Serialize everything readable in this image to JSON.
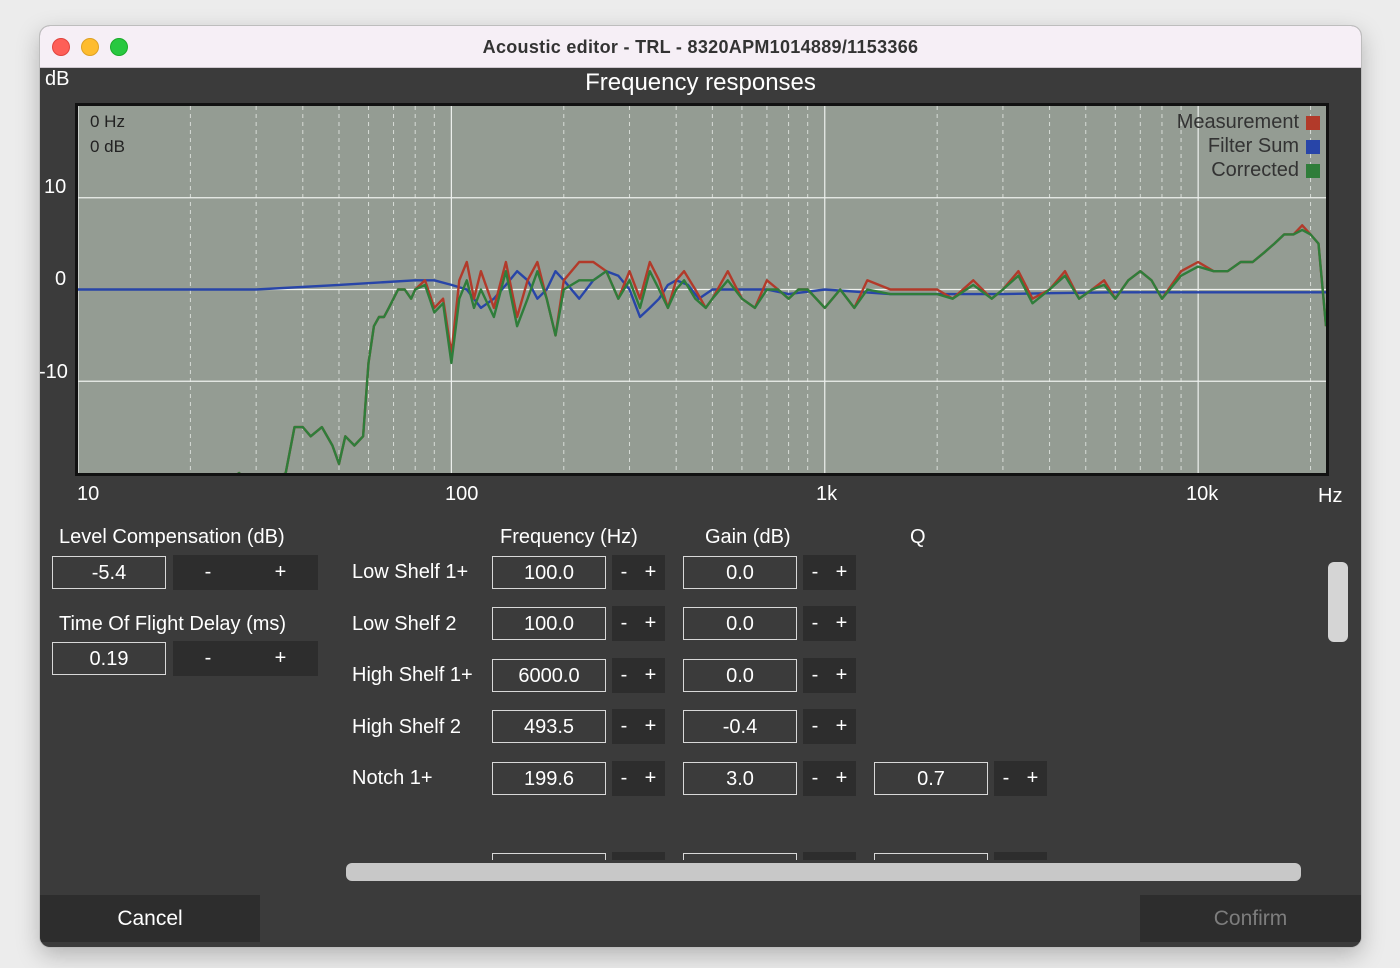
{
  "window": {
    "title": "Acoustic editor - TRL - 8320APM1014889/1153366"
  },
  "chart_data": {
    "type": "line",
    "title": "Frequency responses",
    "ylabel": "dB",
    "xlabel": "Hz",
    "x_scale": "log",
    "xlim": [
      10,
      22000
    ],
    "ylim": [
      -20,
      20
    ],
    "x_tick_labels": [
      "10",
      "100",
      "1k",
      "10k"
    ],
    "x_tick_values": [
      10,
      100,
      1000,
      10000
    ],
    "y_tick_labels": [
      "10",
      "0",
      "-10"
    ],
    "y_tick_values": [
      10,
      0,
      -10
    ],
    "grid": true,
    "legend_position": "top-right",
    "readout": {
      "freq": "0 Hz",
      "level": "0 dB"
    },
    "series": [
      {
        "name": "Measurement",
        "color": "#b23a2a",
        "x": [
          10,
          20,
          23,
          25,
          27,
          30,
          33,
          36,
          38,
          40,
          42,
          45,
          48,
          50,
          52,
          55,
          58,
          60,
          62,
          64,
          66,
          68,
          70,
          72,
          75,
          78,
          80,
          85,
          90,
          95,
          100,
          105,
          110,
          115,
          120,
          130,
          140,
          150,
          160,
          170,
          180,
          190,
          200,
          220,
          240,
          260,
          280,
          300,
          320,
          340,
          360,
          380,
          400,
          420,
          450,
          480,
          500,
          550,
          600,
          650,
          700,
          750,
          800,
          850,
          900,
          1000,
          1100,
          1200,
          1300,
          1500,
          1700,
          2000,
          2200,
          2500,
          2800,
          3000,
          3300,
          3600,
          4000,
          4400,
          4800,
          5200,
          5600,
          6000,
          6500,
          7000,
          7500,
          8000,
          9000,
          10000,
          11000,
          12000,
          13000,
          14000,
          15000,
          16000,
          17000,
          18000,
          19000,
          20000,
          21000,
          22000
        ],
        "y": [
          -22,
          -22,
          -22,
          -21,
          -20,
          -22,
          -21,
          -20,
          -15,
          -15,
          -16,
          -15,
          -17,
          -19,
          -16,
          -17,
          -16,
          -8,
          -4,
          -3,
          -3,
          -2,
          -1,
          0,
          0,
          -1,
          0,
          1,
          -2,
          -1,
          -7,
          1,
          3,
          -1,
          2,
          -2,
          3,
          -3,
          1,
          3,
          -1,
          -5,
          1,
          3,
          3,
          2,
          -1,
          2,
          -1,
          3,
          1,
          -2,
          1,
          2,
          0,
          -2,
          -1,
          2,
          -1,
          -2,
          1,
          0,
          -1,
          0,
          0,
          -2,
          0,
          -2,
          1,
          0,
          0,
          0,
          -1,
          1,
          -1,
          0,
          2,
          -1,
          0,
          2,
          -1,
          0,
          1,
          -1,
          1,
          2,
          1,
          -1,
          2,
          3,
          2,
          2,
          3,
          3,
          4,
          5,
          6,
          6,
          7,
          6,
          5,
          -4
        ]
      },
      {
        "name": "Filter Sum",
        "color": "#2845a8",
        "x": [
          10,
          30,
          50,
          80,
          90,
          100,
          110,
          120,
          130,
          140,
          150,
          160,
          170,
          180,
          190,
          200,
          220,
          240,
          260,
          280,
          300,
          320,
          340,
          360,
          380,
          400,
          430,
          460,
          500,
          600,
          700,
          800,
          1000,
          1500,
          2000,
          3000,
          4000,
          6000,
          10000,
          16000,
          22000
        ],
        "y": [
          0,
          0,
          0.5,
          1,
          1,
          0.5,
          0,
          -2,
          -1,
          0.5,
          2,
          1,
          -1,
          0,
          2,
          1,
          -1,
          1,
          2,
          1.5,
          0,
          -3,
          -2,
          -1,
          0.5,
          1,
          0.5,
          -1,
          0,
          0,
          0,
          -0.5,
          0,
          -0.5,
          -0.5,
          -0.5,
          -0.4,
          -0.3,
          -0.3,
          -0.3,
          -0.3
        ]
      },
      {
        "name": "Corrected",
        "color": "#2f7d3a",
        "x": [
          10,
          20,
          23,
          25,
          27,
          30,
          33,
          36,
          38,
          40,
          42,
          45,
          48,
          50,
          52,
          55,
          58,
          60,
          62,
          64,
          66,
          68,
          70,
          72,
          75,
          78,
          80,
          85,
          90,
          95,
          100,
          105,
          110,
          115,
          120,
          130,
          140,
          150,
          160,
          170,
          180,
          190,
          200,
          220,
          240,
          260,
          280,
          300,
          320,
          340,
          360,
          380,
          400,
          420,
          450,
          480,
          500,
          550,
          600,
          650,
          700,
          750,
          800,
          850,
          900,
          1000,
          1100,
          1200,
          1300,
          1500,
          1700,
          2000,
          2200,
          2500,
          2800,
          3000,
          3300,
          3600,
          4000,
          4400,
          4800,
          5200,
          5600,
          6000,
          6500,
          7000,
          7500,
          8000,
          9000,
          10000,
          11000,
          12000,
          13000,
          14000,
          15000,
          16000,
          17000,
          18000,
          19000,
          20000,
          21000,
          22000
        ],
        "y": [
          -22,
          -22,
          -22,
          -21,
          -20,
          -22,
          -21,
          -20,
          -15,
          -15,
          -16,
          -15,
          -17,
          -19,
          -16,
          -17,
          -16,
          -8,
          -4,
          -3,
          -3,
          -2,
          -1,
          0,
          0,
          -1,
          0,
          0.5,
          -2.5,
          -1.5,
          -8,
          -1,
          1,
          -2,
          0,
          -3,
          2,
          -4,
          -1,
          2,
          -1,
          -5,
          0,
          1,
          1,
          2,
          -1,
          1,
          -2,
          2,
          0,
          -2,
          0,
          1,
          -1,
          -2,
          -1,
          1,
          -1,
          -2,
          0,
          0,
          -1,
          0,
          0,
          -2,
          0,
          -2,
          0,
          -0.5,
          -0.5,
          -0.5,
          -1,
          0.5,
          -1,
          0,
          1.5,
          -1.5,
          0,
          1.5,
          -1,
          0,
          0.5,
          -1,
          1,
          2,
          1,
          -1,
          1.5,
          2.5,
          2,
          2,
          3,
          3,
          4,
          5,
          6,
          6,
          6.5,
          6,
          5,
          -4
        ]
      }
    ]
  },
  "panel": {
    "level_comp_label": "Level Compensation (dB)",
    "level_comp_value": "-5.4",
    "tof_label": "Time Of Flight Delay (ms)",
    "tof_value": "0.19",
    "minus": "-",
    "plus": "+"
  },
  "filters": {
    "headers": {
      "freq": "Frequency (Hz)",
      "gain": "Gain (dB)",
      "q": "Q"
    },
    "rows": [
      {
        "name": "Low Shelf 1+",
        "freq": "100.0",
        "gain": "0.0"
      },
      {
        "name": "Low Shelf 2",
        "freq": "100.0",
        "gain": "0.0"
      },
      {
        "name": "High Shelf 1+",
        "freq": "6000.0",
        "gain": "0.0"
      },
      {
        "name": "High Shelf 2",
        "freq": "493.5",
        "gain": "-0.4"
      },
      {
        "name": "Notch 1+",
        "freq": "199.6",
        "gain": "3.0",
        "q": "0.7"
      }
    ]
  },
  "buttons": {
    "cancel": "Cancel",
    "confirm": "Confirm"
  }
}
